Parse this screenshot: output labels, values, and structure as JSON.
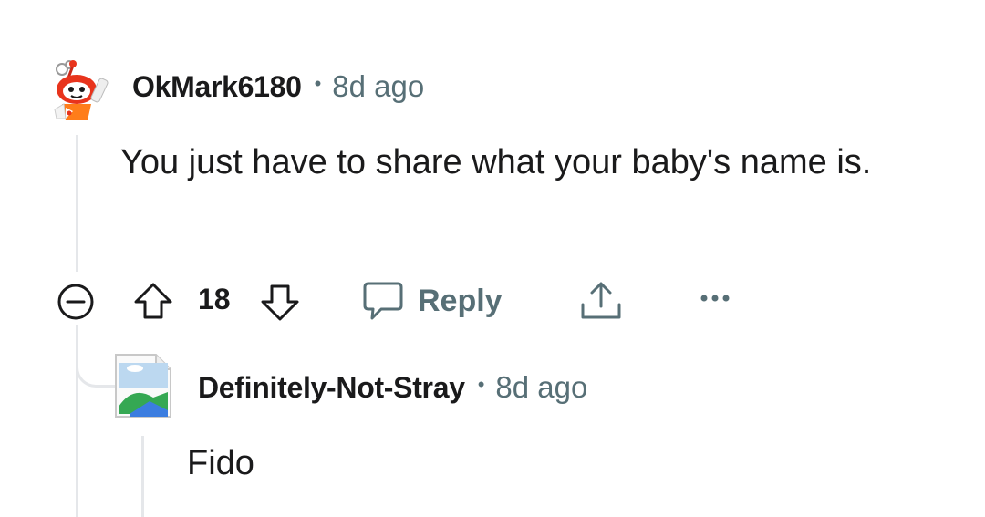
{
  "comment": {
    "author": "OkMark6180",
    "separator": "•",
    "time": "8d ago",
    "body": "You just have to share what your baby's name is.",
    "score": "18",
    "actions": {
      "reply_label": "Reply",
      "collapse_icon": "minus-circle-icon",
      "upvote_icon": "arrow-up-icon",
      "downvote_icon": "arrow-down-icon",
      "reply_icon": "speech-bubble-icon",
      "share_icon": "share-icon",
      "more_icon": "more-dots-icon"
    }
  },
  "reply": {
    "author": "Definitely-Not-Stray",
    "separator": "•",
    "time": "8d ago",
    "body": "Fido"
  },
  "colors": {
    "text": "#1a1a1b",
    "meta": "#576f76",
    "thread_line": "#e5e7ea",
    "snoo_red": "#e8341c",
    "snoo_orange": "#ff7d1a"
  }
}
